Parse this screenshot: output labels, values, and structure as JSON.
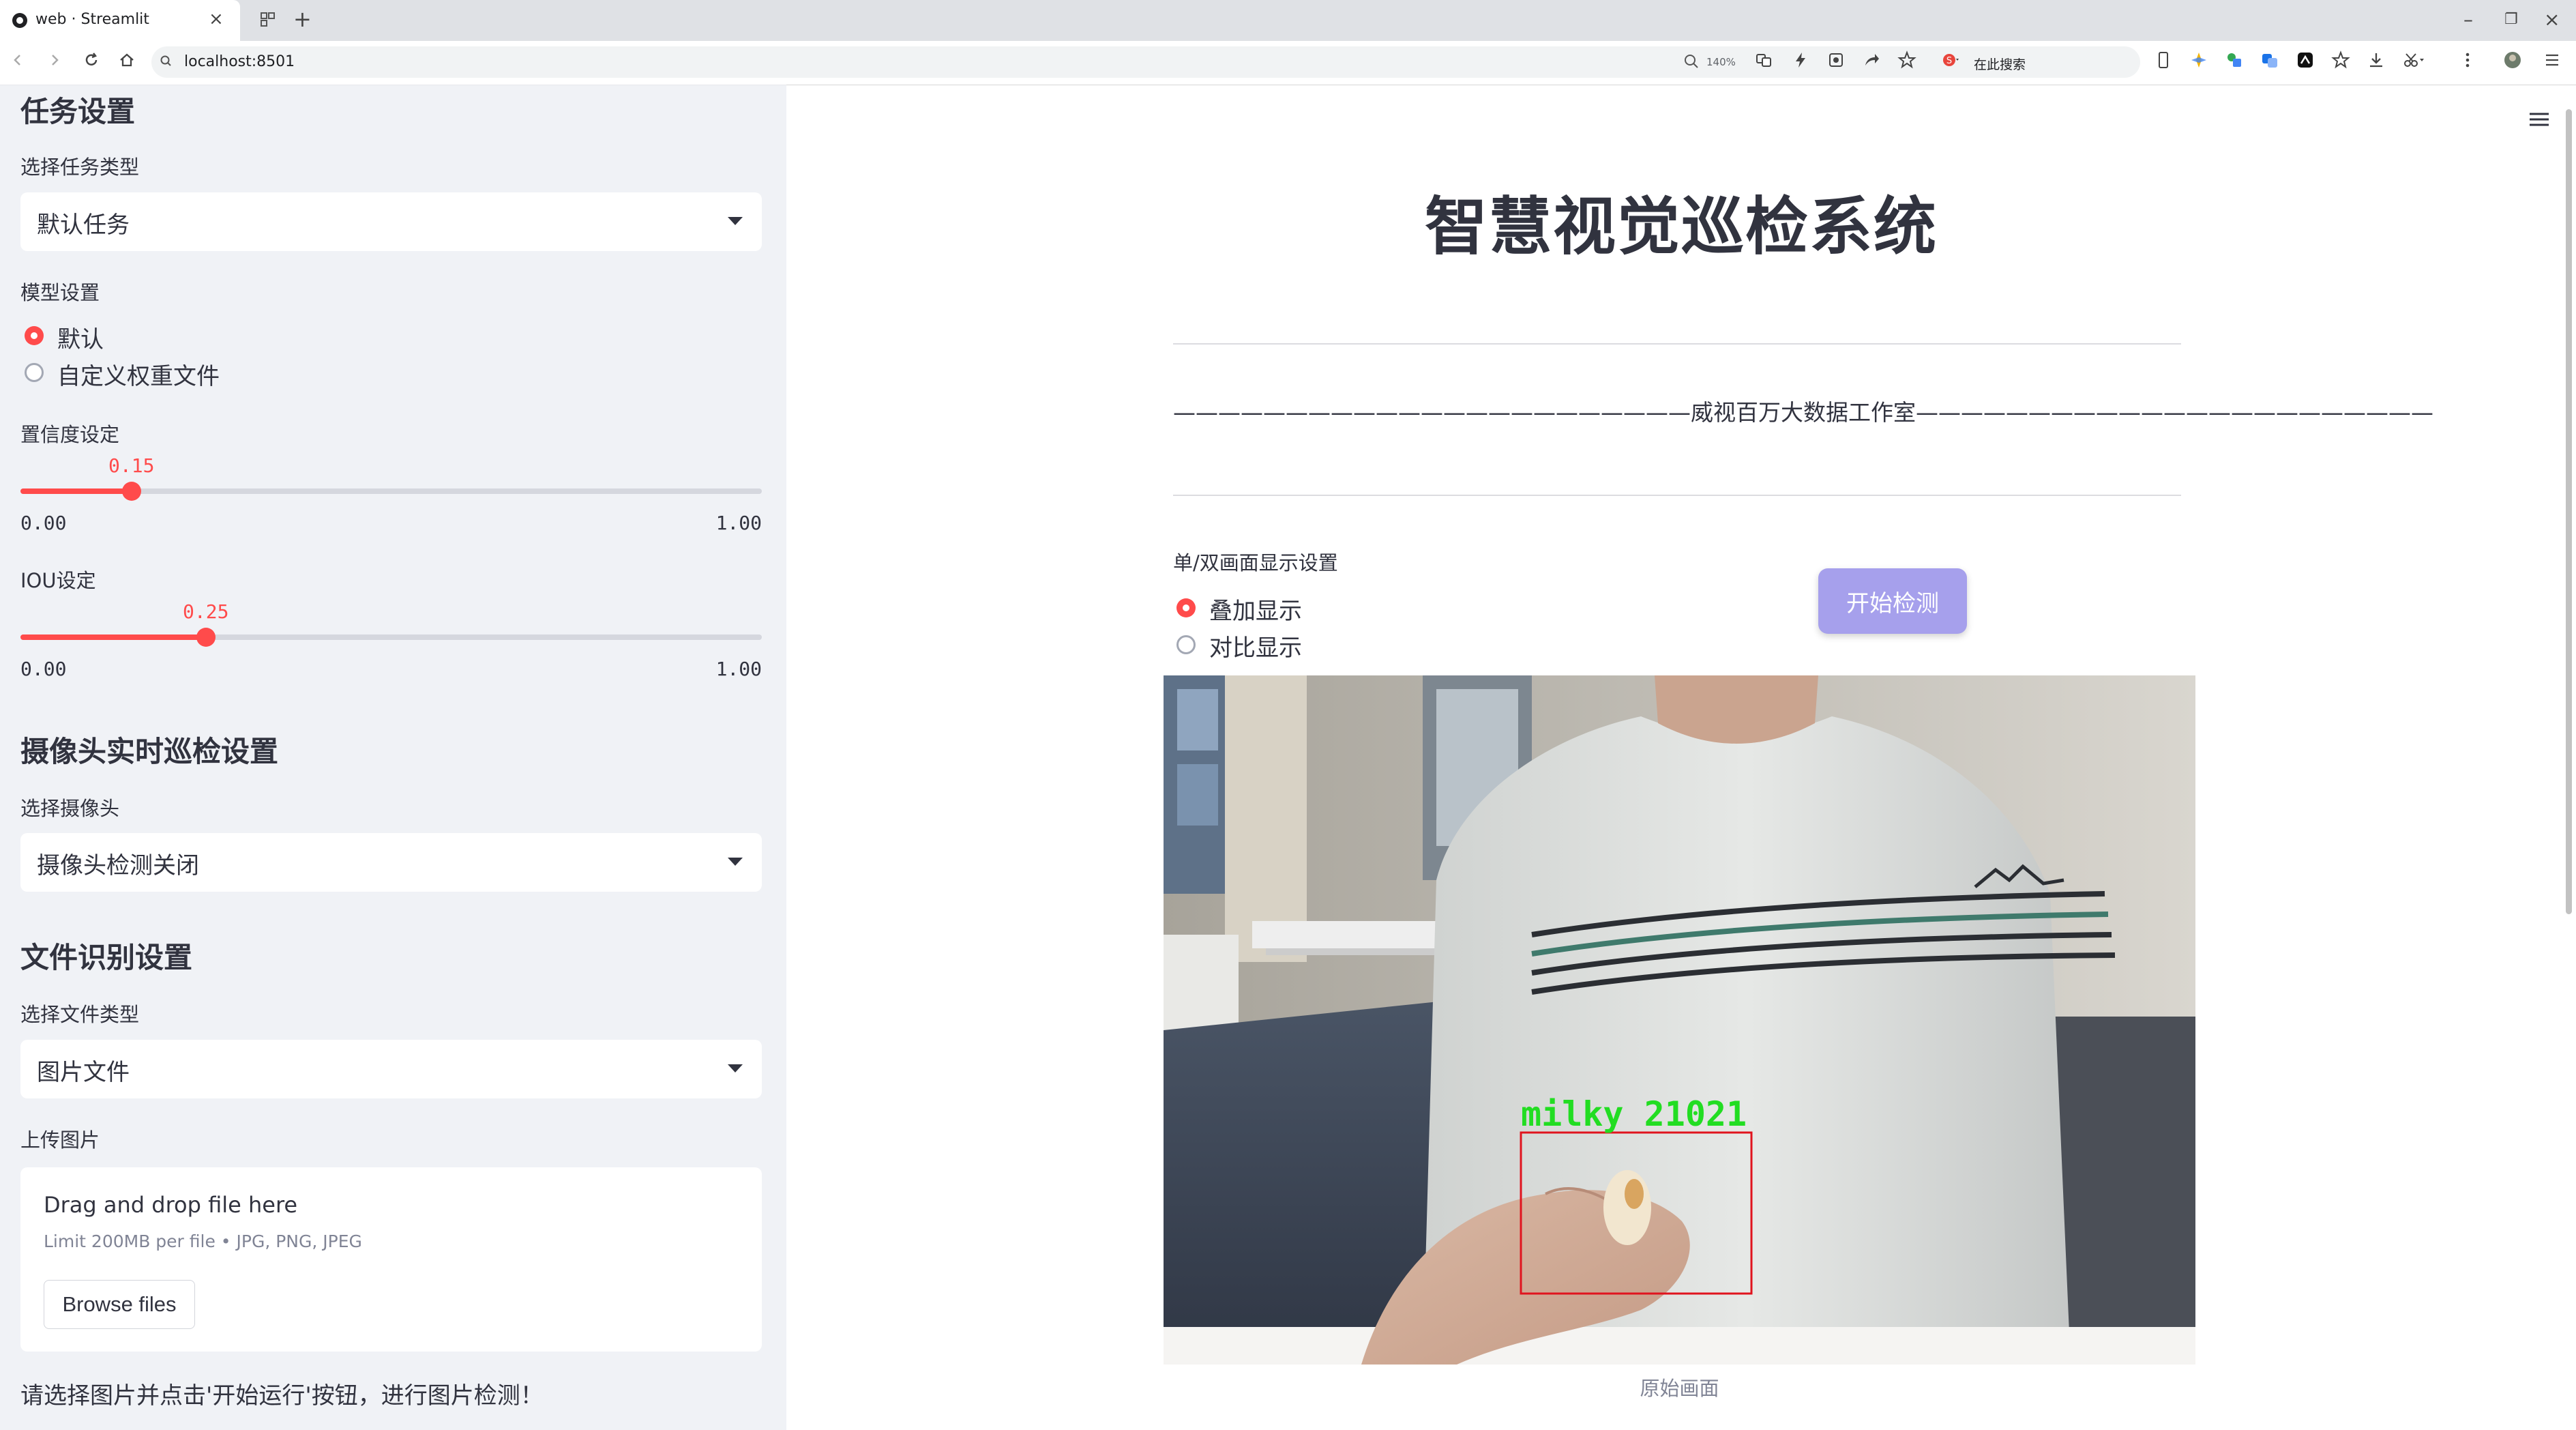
{
  "browser": {
    "tab_title": "web · Streamlit",
    "url": "localhost:8501",
    "zoom": "140%",
    "search_placeholder": "在此搜索"
  },
  "sidebar": {
    "task_section_title": "任务设置",
    "task_type_label": "选择任务类型",
    "task_type_value": "默认任务",
    "model_label": "模型设置",
    "model_options": [
      "默认",
      "自定义权重文件"
    ],
    "model_selected": "默认",
    "confidence": {
      "label": "置信度设定",
      "value": 0.15,
      "value_text": "0.15",
      "min": "0.00",
      "max": "1.00"
    },
    "iou": {
      "label": "IOU设定",
      "value": 0.25,
      "value_text": "0.25",
      "min": "0.00",
      "max": "1.00"
    },
    "camera_section_title": "摄像头实时巡检设置",
    "camera_label": "选择摄像头",
    "camera_value": "摄像头检测关闭",
    "file_section_title": "文件识别设置",
    "file_type_label": "选择文件类型",
    "file_type_value": "图片文件",
    "upload_label": "上传图片",
    "upload_title": "Drag and drop file here",
    "upload_limit": "Limit 200MB per file • JPG, PNG, JPEG",
    "browse_button": "Browse files",
    "hint": "请选择图片并点击'开始运行'按钮，进行图片检测！"
  },
  "main": {
    "title": "智慧视觉巡检系统",
    "studio_line": "———————————————————————威视百万大数据工作室———————————————————————",
    "display_label": "单/双画面显示设置",
    "display_options": [
      "叠加显示",
      "对比显示"
    ],
    "display_selected": "叠加显示",
    "start_button": "开始检测",
    "detection_label": "milky 21021",
    "caption": "原始画面"
  },
  "colors": {
    "accent": "#ff4b4b",
    "button": "#a6a0ec",
    "sidebar_bg": "#f0f2f6",
    "detection_box": "#e0141e",
    "detection_text": "#22dd22"
  }
}
